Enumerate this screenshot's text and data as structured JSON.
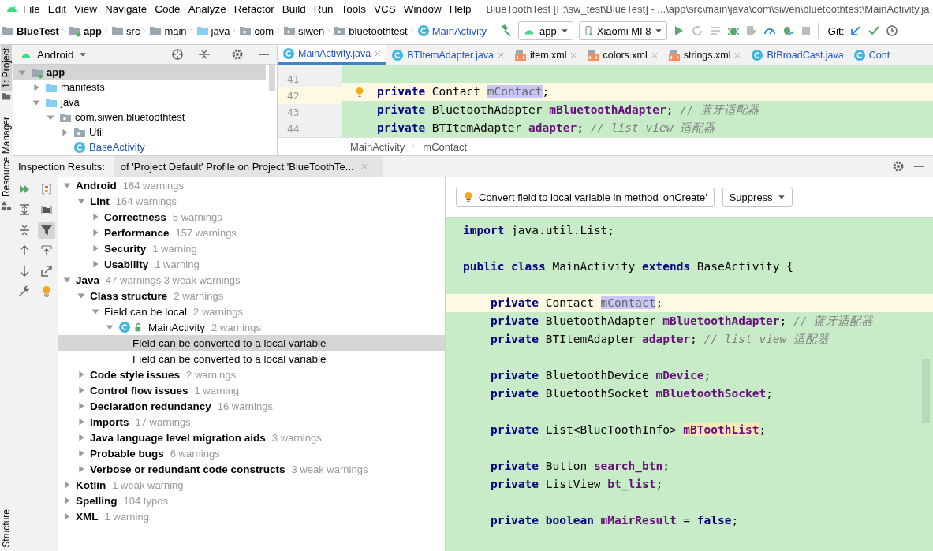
{
  "menu": {
    "items": [
      "File",
      "Edit",
      "View",
      "Navigate",
      "Code",
      "Analyze",
      "Refactor",
      "Build",
      "Run",
      "Tools",
      "VCS",
      "Window",
      "Help"
    ],
    "title": "BlueToothTest [F:\\sw_test\\BlueTest] - ...\\app\\src\\main\\java\\com\\siwen\\bluetoothtest\\MainActivity.ja"
  },
  "breadcrumbs": [
    {
      "label": "BlueTest",
      "kind": "project"
    },
    {
      "label": "app",
      "kind": "module"
    },
    {
      "label": "src",
      "kind": "folder"
    },
    {
      "label": "main",
      "kind": "folder"
    },
    {
      "label": "java",
      "kind": "source"
    },
    {
      "label": "com",
      "kind": "package"
    },
    {
      "label": "siwen",
      "kind": "package"
    },
    {
      "label": "bluetoothtest",
      "kind": "package"
    },
    {
      "label": "MainActivity",
      "kind": "class"
    }
  ],
  "toolbar": {
    "run_config": "app",
    "device": "Xiaomi MI 8",
    "git_label": "Git:"
  },
  "side_tabs": [
    {
      "label": "1: Project",
      "selected": true
    },
    {
      "label": "Resource Manager",
      "selected": false
    },
    {
      "label": "Structure",
      "selected": false
    }
  ],
  "project": {
    "view": "Android",
    "tree": [
      {
        "label": "app",
        "kind": "module",
        "expanded": true,
        "selected": true,
        "children": [
          {
            "label": "manifests",
            "kind": "folder",
            "expanded": false,
            "selected": false
          },
          {
            "label": "java",
            "kind": "folder",
            "expanded": true,
            "selected": false,
            "children": [
              {
                "label": "com.siwen.bluetoothtest",
                "kind": "package",
                "expanded": true,
                "selected": false,
                "children": [
                  {
                    "label": "Util",
                    "kind": "package",
                    "expanded": false,
                    "selected": false
                  },
                  {
                    "label": "BaseActivity",
                    "kind": "class",
                    "selected": false
                  }
                ]
              }
            ]
          }
        ]
      }
    ]
  },
  "editor": {
    "tabs": [
      {
        "label": "MainActivity.java",
        "kind": "java",
        "selected": true,
        "closable": true
      },
      {
        "label": "BTItemAdapter.java",
        "kind": "java",
        "selected": false,
        "closable": true
      },
      {
        "label": "item.xml",
        "kind": "xml",
        "selected": false,
        "closable": true
      },
      {
        "label": "colors.xml",
        "kind": "xml",
        "selected": false,
        "closable": true
      },
      {
        "label": "strings.xml",
        "kind": "xml",
        "selected": false,
        "closable": true
      },
      {
        "label": "BtBroadCast.java",
        "kind": "java",
        "selected": false,
        "closable": false
      },
      {
        "label": "Cont",
        "kind": "java",
        "selected": false,
        "closable": false
      }
    ],
    "lines": [
      {
        "number": "41",
        "current": false,
        "bulb": false
      },
      {
        "number": "42",
        "current": true,
        "bulb": true,
        "tokens": [
          {
            "kind": "kw",
            "text": "private"
          },
          {
            "kind": "plain",
            "text": " Contact "
          },
          {
            "kind": "ref",
            "text": "mContact"
          },
          {
            "kind": "plain",
            "text": ";"
          }
        ]
      },
      {
        "number": "43",
        "current": false,
        "bulb": false,
        "tokens": [
          {
            "kind": "kw",
            "text": "private"
          },
          {
            "kind": "plain",
            "text": " BluetoothAdapter "
          },
          {
            "kind": "field",
            "text": "mBluetoothAdapter"
          },
          {
            "kind": "plain",
            "text": "; "
          },
          {
            "kind": "comment",
            "text": "// 蓝牙适配器"
          }
        ]
      },
      {
        "number": "44",
        "current": false,
        "bulb": false,
        "tokens": [
          {
            "kind": "kw",
            "text": "private"
          },
          {
            "kind": "plain",
            "text": " BTItemAdapter "
          },
          {
            "kind": "field",
            "text": "adapter"
          },
          {
            "kind": "plain",
            "text": "; "
          },
          {
            "kind": "comment",
            "text": "// list view 适配器"
          }
        ]
      }
    ],
    "breadcrumb": [
      "MainActivity",
      "mContact"
    ]
  },
  "inspection": {
    "title": "Inspection Results:",
    "tab": "of 'Project Default' Profile on Project 'BlueToothTe...",
    "tree": [
      {
        "label": "Android",
        "count": "164 warnings",
        "kind": "group",
        "expanded": true,
        "selected": false,
        "children": [
          {
            "label": "Lint",
            "count": "164 warnings",
            "kind": "group",
            "expanded": true,
            "selected": false,
            "children": [
              {
                "label": "Correctness",
                "count": "5 warnings",
                "kind": "group",
                "expanded": false,
                "selected": false
              },
              {
                "label": "Performance",
                "count": "157 warnings",
                "kind": "group",
                "expanded": false,
                "selected": false
              },
              {
                "label": "Security",
                "count": "1 warning",
                "kind": "group",
                "expanded": false,
                "selected": false
              },
              {
                "label": "Usability",
                "count": "1 warning",
                "kind": "group",
                "expanded": false,
                "selected": false
              }
            ]
          }
        ]
      },
      {
        "label": "Java",
        "count": "47 warnings 3 weak warnings",
        "kind": "group",
        "expanded": true,
        "selected": false,
        "children": [
          {
            "label": "Class structure",
            "count": "2 warnings",
            "kind": "group",
            "expanded": true,
            "selected": false,
            "children": [
              {
                "label": "Field can be local",
                "count": "2 warnings",
                "kind": "inspection",
                "expanded": true,
                "selected": false,
                "children": [
                  {
                    "label": "MainActivity",
                    "count": "2 warnings",
                    "kind": "class",
                    "expanded": true,
                    "selected": false,
                    "children": [
                      {
                        "label": "Field can be converted to a local variable",
                        "kind": "problem",
                        "selected": true
                      },
                      {
                        "label": "Field can be converted to a local variable",
                        "kind": "problem",
                        "selected": false
                      }
                    ]
                  }
                ]
              }
            ]
          },
          {
            "label": "Code style issues",
            "count": "2 warnings",
            "kind": "group",
            "expanded": false,
            "selected": false
          },
          {
            "label": "Control flow issues",
            "count": "1 warning",
            "kind": "group",
            "expanded": false,
            "selected": false
          },
          {
            "label": "Declaration redundancy",
            "count": "16 warnings",
            "kind": "group",
            "expanded": false,
            "selected": false
          },
          {
            "label": "Imports",
            "count": "17 warnings",
            "kind": "group",
            "expanded": false,
            "selected": false
          },
          {
            "label": "Java language level migration aids",
            "count": "3 warnings",
            "kind": "group",
            "expanded": false,
            "selected": false
          },
          {
            "label": "Probable bugs",
            "count": "6 warnings",
            "kind": "group",
            "expanded": false,
            "selected": false
          },
          {
            "label": "Verbose or redundant code constructs",
            "count": "3 weak warnings",
            "kind": "group",
            "expanded": false,
            "selected": false
          }
        ]
      },
      {
        "label": "Kotlin",
        "count": "1 weak warning",
        "kind": "group",
        "expanded": false,
        "selected": false
      },
      {
        "label": "Spelling",
        "count": "104 typos",
        "kind": "group",
        "expanded": false,
        "selected": false
      },
      {
        "label": "XML",
        "count": "1 warning",
        "kind": "group",
        "expanded": false,
        "selected": false
      }
    ],
    "fix_button": "Convert field to local variable in method 'onCreate'",
    "suppress": "Suppress",
    "code": [
      {
        "current": false,
        "tokens": [
          {
            "kind": "kw",
            "text": "import"
          },
          {
            "kind": "plain",
            "text": " java.util.List;"
          }
        ]
      },
      {
        "current": false
      },
      {
        "current": false,
        "tokens": [
          {
            "kind": "kw",
            "text": "public class"
          },
          {
            "kind": "plain",
            "text": " MainActivity "
          },
          {
            "kind": "kw",
            "text": "extends"
          },
          {
            "kind": "plain",
            "text": " BaseActivity {"
          }
        ]
      },
      {
        "current": false
      },
      {
        "current": true,
        "tokens": [
          {
            "kind": "kw",
            "text": "    private"
          },
          {
            "kind": "plain",
            "text": " Contact "
          },
          {
            "kind": "ref",
            "text": "mContact"
          },
          {
            "kind": "plain",
            "text": ";"
          }
        ]
      },
      {
        "current": false,
        "tokens": [
          {
            "kind": "kw",
            "text": "    private"
          },
          {
            "kind": "plain",
            "text": " BluetoothAdapter "
          },
          {
            "kind": "field",
            "text": "mBluetoothAdapter"
          },
          {
            "kind": "plain",
            "text": "; "
          },
          {
            "kind": "comment",
            "text": "// 蓝牙适配器"
          }
        ]
      },
      {
        "current": false,
        "tokens": [
          {
            "kind": "kw",
            "text": "    private"
          },
          {
            "kind": "plain",
            "text": " BTItemAdapter "
          },
          {
            "kind": "field",
            "text": "adapter"
          },
          {
            "kind": "plain",
            "text": "; "
          },
          {
            "kind": "comment",
            "text": "// list view 适配器"
          }
        ]
      },
      {
        "current": false
      },
      {
        "current": false,
        "tokens": [
          {
            "kind": "kw",
            "text": "    private"
          },
          {
            "kind": "plain",
            "text": " BluetoothDevice "
          },
          {
            "kind": "field",
            "text": "mDevice"
          },
          {
            "kind": "plain",
            "text": ";"
          }
        ]
      },
      {
        "current": false,
        "tokens": [
          {
            "kind": "kw",
            "text": "    private"
          },
          {
            "kind": "plain",
            "text": " BluetoothSocket "
          },
          {
            "kind": "field",
            "text": "mBluetoothSocket"
          },
          {
            "kind": "plain",
            "text": ";"
          }
        ]
      },
      {
        "current": false
      },
      {
        "current": false,
        "tokens": [
          {
            "kind": "kw",
            "text": "    private"
          },
          {
            "kind": "plain",
            "text": " List<BlueToothInfo> "
          },
          {
            "kind": "warn",
            "text": "mBToothList"
          },
          {
            "kind": "plain",
            "text": ";"
          }
        ]
      },
      {
        "current": false
      },
      {
        "current": false,
        "tokens": [
          {
            "kind": "kw",
            "text": "    private"
          },
          {
            "kind": "plain",
            "text": " Button "
          },
          {
            "kind": "field",
            "text": "search_btn"
          },
          {
            "kind": "plain",
            "text": ";"
          }
        ]
      },
      {
        "current": false,
        "tokens": [
          {
            "kind": "kw",
            "text": "    private"
          },
          {
            "kind": "plain",
            "text": " ListView "
          },
          {
            "kind": "field",
            "text": "bt_list"
          },
          {
            "kind": "plain",
            "text": ";"
          }
        ]
      },
      {
        "current": false
      },
      {
        "current": false,
        "tokens": [
          {
            "kind": "kw",
            "text": "    private"
          },
          {
            "kind": "kw",
            "text": " boolean "
          },
          {
            "kind": "field",
            "text": "mMairResult"
          },
          {
            "kind": "plain",
            "text": " = "
          },
          {
            "kind": "kw",
            "text": "false"
          },
          {
            "kind": "plain",
            "text": ";"
          }
        ]
      }
    ]
  }
}
